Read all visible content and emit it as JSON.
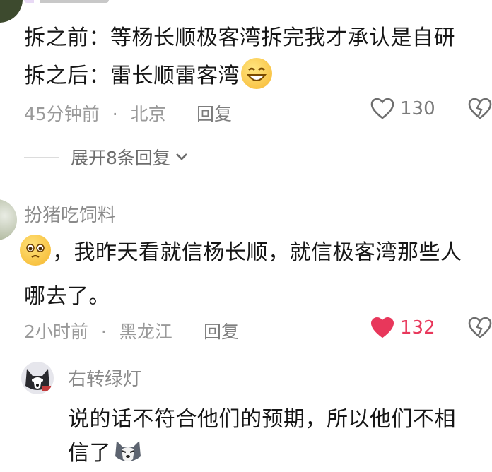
{
  "comments": [
    {
      "text_line1": "拆之前：等杨长顺极客湾拆完我才承认是自研",
      "text_line2": "拆之后：雷长顺雷客湾",
      "time": "45分钟前",
      "location": "北京",
      "reply_label": "回复",
      "like_count": "130",
      "expand_label": "展开8条回复"
    },
    {
      "username": "扮猪吃饲料",
      "text_line1": "，我昨天看就信杨长顺，就信极客湾那些人",
      "text_line2": "哪去了。",
      "time": "2小时前",
      "location": "黑龙江",
      "reply_label": "回复",
      "like_count": "132"
    },
    {
      "username": "右转绿灯",
      "text_line1": "说的话不符合他们的预期，所以他们不相",
      "text_line2": "信了"
    }
  ],
  "separator": "·",
  "colors": {
    "like_active": "#e8375b",
    "meta": "#9a9a9a"
  },
  "icons": [
    "heart-icon",
    "dislike-heart-icon",
    "chevron-down-icon",
    "grin-emoji",
    "pleading-emoji",
    "husky-emoji"
  ]
}
